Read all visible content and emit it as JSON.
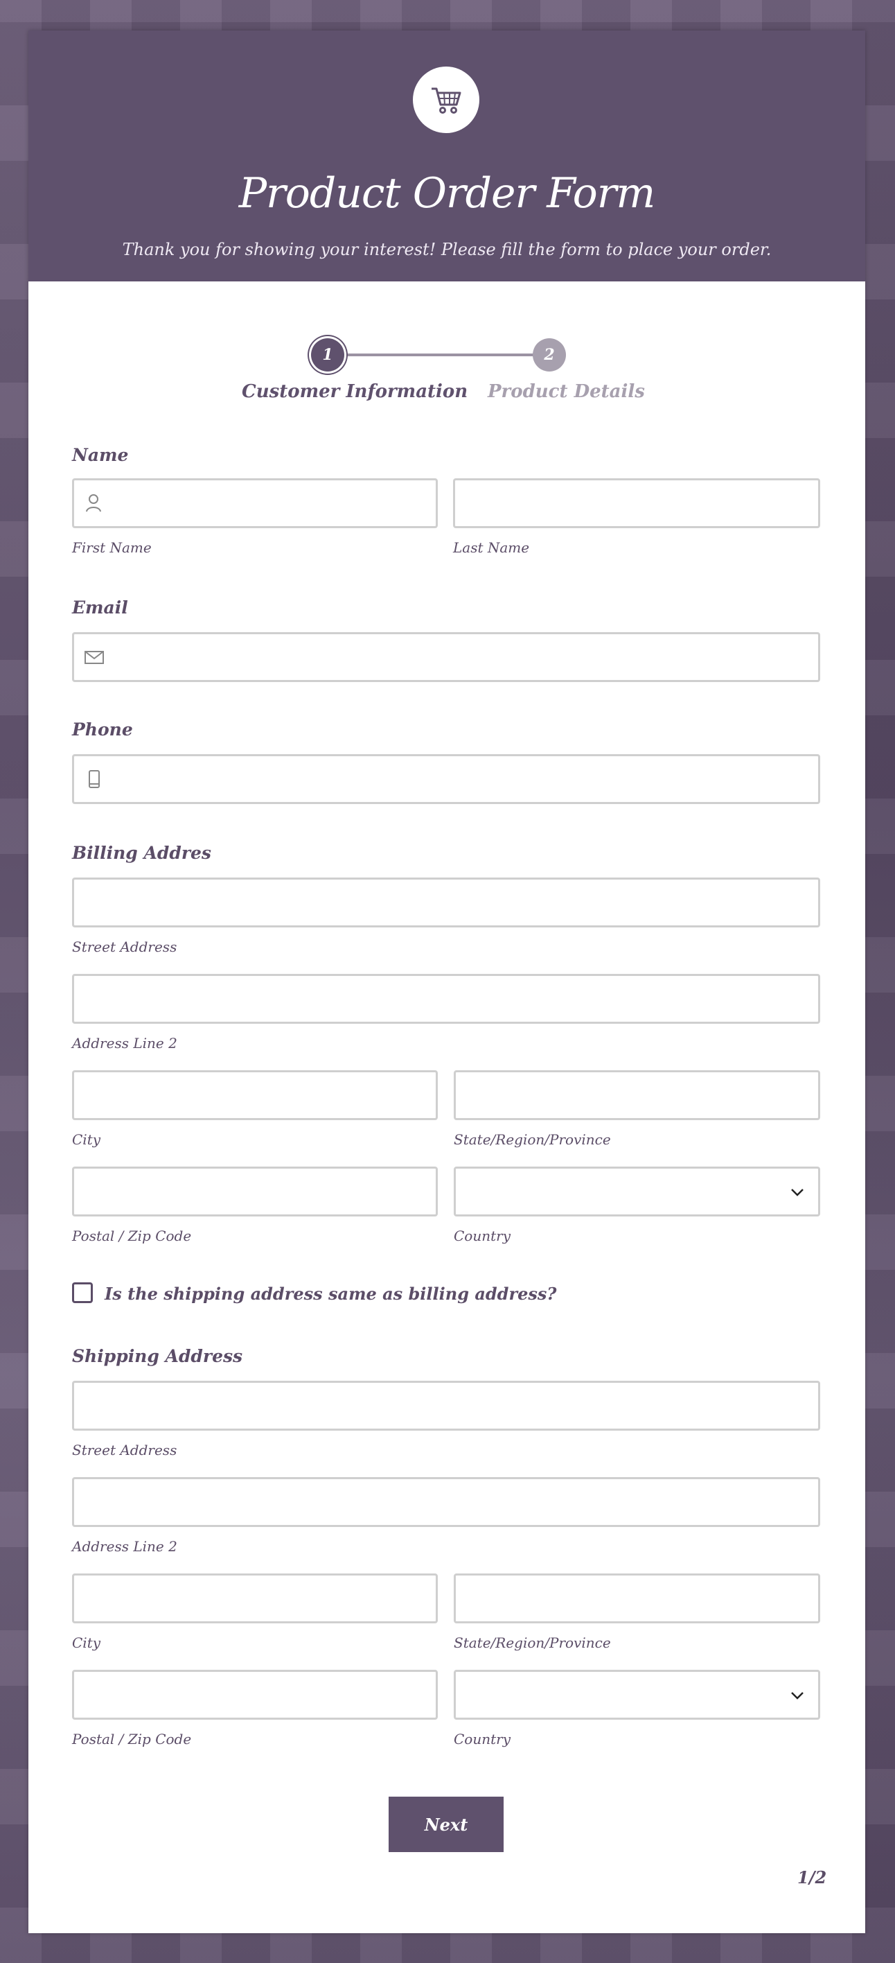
{
  "form": {
    "title": "Product Order Form",
    "subtitle": "Thank you for showing your interest! Please fill the form to place your order."
  },
  "steps": [
    {
      "number": "1",
      "label": "Customer Information",
      "state": "active"
    },
    {
      "number": "2",
      "label": "Product Details",
      "state": "inactive"
    }
  ],
  "fields": {
    "name": {
      "label": "Name",
      "first": "First Name",
      "last": "Last Name"
    },
    "email": {
      "label": "Email"
    },
    "phone": {
      "label": "Phone"
    },
    "billing": {
      "label": "Billing Addres",
      "street": "Street Address",
      "line2": "Address Line 2",
      "city": "City",
      "state": "State/Region/Province",
      "postal": "Postal / Zip Code",
      "country": "Country"
    },
    "same_as_billing": {
      "label": "Is the shipping address same as billing address?",
      "checked": false
    },
    "shipping": {
      "label": "Shipping Address",
      "street": "Street Address",
      "line2": "Address Line 2",
      "city": "City",
      "state": "State/Region/Province",
      "postal": "Postal / Zip Code",
      "country": "Country"
    }
  },
  "actions": {
    "next": "Next"
  },
  "pagination": "1/2",
  "colors": {
    "accent": "#5f516d",
    "inactive": "#a7a0ae",
    "border": "#cfcfcf"
  },
  "icons": [
    "shopping-cart-icon",
    "user-icon",
    "envelope-icon",
    "phone-icon",
    "chevron-down-icon"
  ]
}
